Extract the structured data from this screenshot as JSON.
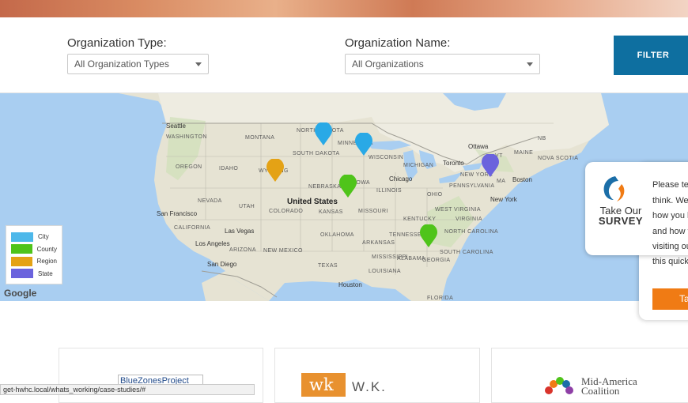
{
  "filters": {
    "org_type_label": "Organization Type:",
    "org_type_value": "All Organization Types",
    "org_name_label": "Organization Name:",
    "org_name_value": "All Organizations",
    "filter_button": "FILTER"
  },
  "map": {
    "labels": {
      "seattle": "Seattle",
      "washington": "WASHINGTON",
      "montana": "MONTANA",
      "north_dakota": "NORTH DAKOTA",
      "minnesota": "MINNESOTA",
      "south_dakota": "SOUTH DAKOTA",
      "wisconsin": "WISCONSIN",
      "michigan": "MICHIGAN",
      "ottawa": "Ottawa",
      "toronto": "Toronto",
      "maine": "MAINE",
      "nb": "NB",
      "nova_scotia": "NOVA SCOTIA",
      "vt": "VT",
      "oregon": "OREGON",
      "idaho": "IDAHO",
      "wyoming": "WYOMING",
      "nebraska": "NEBRASKA",
      "iowa": "IOWA",
      "chicago": "Chicago",
      "illinois": "ILLINOIS",
      "ohio": "OHIO",
      "new_york_state": "NEW YORK",
      "pennsylvania": "PENNSYLVANIA",
      "ma": "MA",
      "boston": "Boston",
      "new_york": "New York",
      "nevada": "NEVADA",
      "utah": "UTAH",
      "united_states": "United States",
      "colorado": "COLORADO",
      "kansas": "KANSAS",
      "missouri": "MISSOURI",
      "kentucky": "KENTUCKY",
      "west_virginia": "WEST VIRGINIA",
      "virginia": "VIRGINIA",
      "san_francisco": "San Francisco",
      "california": "CALIFORNIA",
      "las_vegas": "Las Vegas",
      "oklahoma": "OKLAHOMA",
      "tennessee": "TENNESSEE",
      "north_carolina": "NORTH CAROLINA",
      "los_angeles": "Los Angeles",
      "arizona": "ARIZONA",
      "new_mexico": "NEW MEXICO",
      "arkansas": "ARKANSAS",
      "south_carolina": "SOUTH CAROLINA",
      "san_diego": "San Diego",
      "mississippi": "MISSISSIPPI",
      "alabama": "ALABAMA",
      "georgia": "GEORGIA",
      "texas": "TEXAS",
      "louisiana": "LOUISIANA",
      "houston": "Houston",
      "florida": "FLORIDA",
      "google": "Google"
    },
    "pins": [
      {
        "type": "City",
        "color": "#29a9e6"
      },
      {
        "type": "City",
        "color": "#29a9e6"
      },
      {
        "type": "Region",
        "color": "#e4a215"
      },
      {
        "type": "County",
        "color": "#4fc41a"
      },
      {
        "type": "State",
        "color": "#6b63dd"
      },
      {
        "type": "County",
        "color": "#4fc41a"
      }
    ]
  },
  "legend": {
    "items": [
      {
        "label": "City",
        "color": "#4db8ea"
      },
      {
        "label": "County",
        "color": "#4fc41a"
      },
      {
        "label": "Region",
        "color": "#e4a215"
      },
      {
        "label": "State",
        "color": "#6b63dd"
      }
    ]
  },
  "survey": {
    "title_line1": "Take Our",
    "title_line2": "SURVEY",
    "lines": [
      "Please tel",
      "think. We",
      "how you h",
      "and how w",
      "visiting ou",
      "this quick"
    ],
    "button": "Ta"
  },
  "cards": {
    "card1_logo_alt": "BlueZonesProject",
    "card2_wk_mark": "wk",
    "card2_text": "W.K.",
    "card3_line1": "Mid-America",
    "card3_line2": "Coalition"
  },
  "status_bar": "get-hwhc.local/whats_working/case-studies/#",
  "colors": {
    "filter_button": "#0e6fa0",
    "survey_button": "#f07b14",
    "water": "#a9cef1",
    "land": "#e9e6d8"
  }
}
